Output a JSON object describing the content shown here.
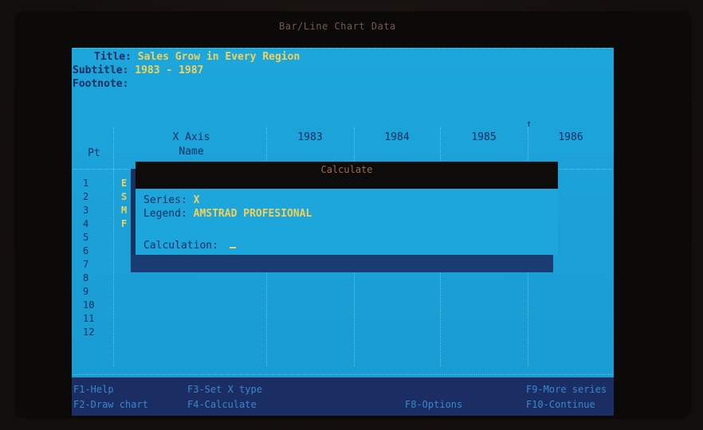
{
  "window": {
    "title": "Bar/Line Chart Data"
  },
  "header": {
    "title_key": "Title:",
    "title_value": "Sales Grow in Every Region",
    "subtitle_key": "Subtitle:",
    "subtitle_value": "1983 - 1987",
    "footnote_key": "Footnote:",
    "footnote_value": ""
  },
  "grid": {
    "pt_label": "Pt",
    "x_axis_label": "X Axis",
    "name_label": "Name",
    "years": [
      "1983",
      "1984",
      "1985",
      "1986"
    ],
    "rows": [
      "1",
      "2",
      "3",
      "4",
      "5",
      "6",
      "7",
      "8",
      "9",
      "10",
      "11",
      "12"
    ],
    "row_initials": [
      "E",
      "S",
      "M",
      "F"
    ]
  },
  "dialog": {
    "title": "Calculate",
    "series_label": "Series:",
    "series_value": "X",
    "legend_label": "Legend:",
    "legend_value": "AMSTRAD PROFESIONAL",
    "calc_label": "Calculation:",
    "calc_value": ""
  },
  "function_keys": {
    "f1": "F1-Help",
    "f2": "F2-Draw chart",
    "f3": "F3-Set X type",
    "f4": "F4-Calculate",
    "f8": "F8-Options",
    "f9": "F9-More series",
    "f10": "F10-Continue"
  }
}
